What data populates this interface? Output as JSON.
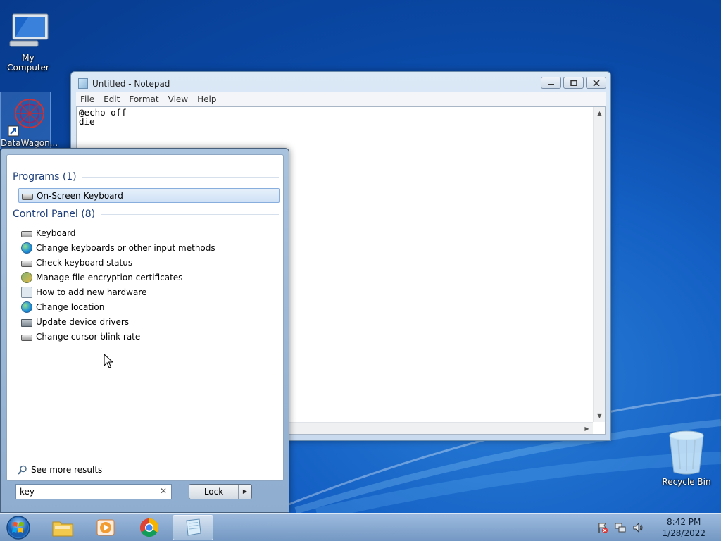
{
  "desktop": {
    "icons": [
      {
        "label": "My Computer"
      },
      {
        "label": "DataWagon..."
      },
      {
        "label": "Recycle Bin"
      }
    ]
  },
  "notepad": {
    "title": "Untitled - Notepad",
    "menu": [
      "File",
      "Edit",
      "Format",
      "View",
      "Help"
    ],
    "content": "@echo off\ndie"
  },
  "start_menu": {
    "programs_header": "Programs (1)",
    "programs": [
      {
        "label": "On-Screen Keyboard",
        "icon": "keyboard-icon",
        "selected": true
      }
    ],
    "control_panel_header": "Control Panel (8)",
    "control_panel": [
      {
        "label": "Keyboard",
        "icon": "keyboard-icon"
      },
      {
        "label": "Change keyboards or other input methods",
        "icon": "globe-icon"
      },
      {
        "label": "Check keyboard status",
        "icon": "keyboard-icon"
      },
      {
        "label": "Manage file encryption certificates",
        "icon": "certificate-icon"
      },
      {
        "label": "How to add new hardware",
        "icon": "hardware-icon"
      },
      {
        "label": "Change location",
        "icon": "globe-icon"
      },
      {
        "label": "Update device drivers",
        "icon": "driver-icon"
      },
      {
        "label": "Change cursor blink rate",
        "icon": "keyboard-icon"
      }
    ],
    "see_more": "See more results",
    "search_value": "key",
    "lock_label": "Lock"
  },
  "taskbar": {
    "time": "8:42 PM",
    "date": "1/28/2022"
  },
  "colors": {
    "desktop": "#1460c4",
    "selection": "#cfe1f6",
    "group_header": "#1e3f7a"
  }
}
